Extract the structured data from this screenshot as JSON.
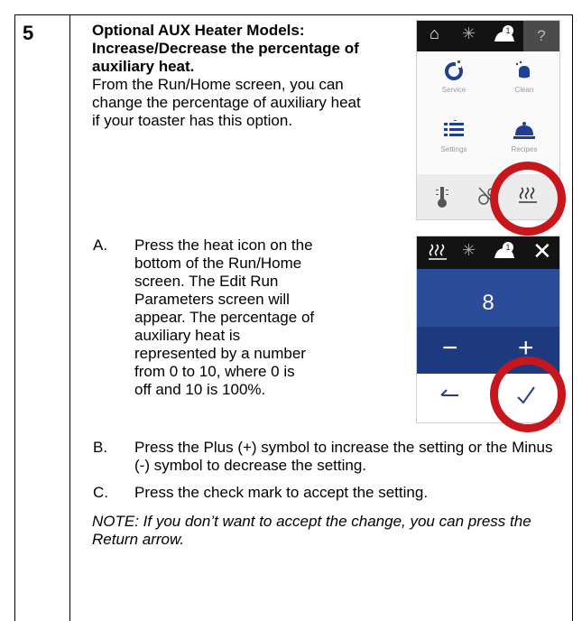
{
  "step": {
    "number": "5"
  },
  "intro": {
    "bold_title": "Optional AUX Heater Models: Increase/Decrease the percentage of auxiliary heat.",
    "body": "From the Run/Home screen, you can change the percentage of auxiliary heat if your toaster has this option."
  },
  "items": [
    {
      "label": "A.",
      "text": "Press the heat icon on the bottom of the Run/Home screen. The Edit Run Parameters screen will appear. The percentage of auxiliary heat is represented by a number from 0 to 10, where 0 is off and 10 is 100%."
    },
    {
      "label": "B.",
      "text": "Press the Plus (+) symbol to increase the setting or the Minus (-) symbol to decrease the setting."
    },
    {
      "label": "C.",
      "text": "Press the check mark to accept the setting."
    }
  ],
  "note": "NOTE: If you don’t want to accept the change, you can press the Return arrow.",
  "screen1": {
    "help_glyph": "?",
    "service_label": "Service",
    "clean_label": "Clean",
    "settings_label": "Settings",
    "recipes_label": "Recipes"
  },
  "screen2": {
    "value": "8",
    "minus": "−",
    "plus": "+"
  },
  "colors": {
    "highlight_ring": "#c8161d",
    "panel_blue": "#2a4c99",
    "panel_blue_dark": "#1d3a7e",
    "accent_icon": "#1f3f91"
  },
  "icons": [
    "home-icon",
    "snowflake-icon",
    "toaster-alert-icon",
    "help-icon",
    "service-icon",
    "clean-icon",
    "settings-icon",
    "recipes-icon",
    "thermometer-icon",
    "fan-off-icon",
    "heat-icon",
    "close-icon",
    "return-arrow-icon",
    "check-icon"
  ]
}
